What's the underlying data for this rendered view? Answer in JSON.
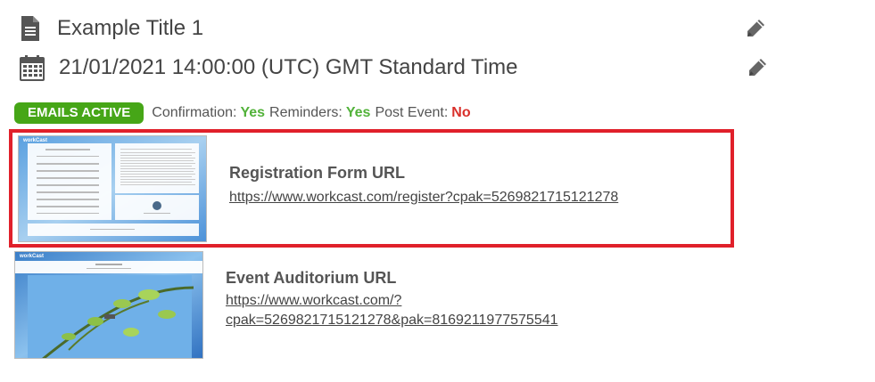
{
  "event": {
    "title": "Example Title 1",
    "datetime": "21/01/2021 14:00:00 (UTC) GMT Standard Time"
  },
  "status": {
    "badge": "EMAILS ACTIVE",
    "confirmation_label": "Confirmation:",
    "confirmation_value": "Yes",
    "reminders_label": "Reminders:",
    "reminders_value": "Yes",
    "post_event_label": "Post Event:",
    "post_event_value": "No"
  },
  "links": {
    "registration": {
      "title": "Registration Form URL",
      "url": "https://www.workcast.com/register?cpak=5269821715121278"
    },
    "auditorium": {
      "title": "Event Auditorium URL",
      "url_line1": "https://www.workcast.com/?",
      "url_line2": "cpak=5269821715121278&pak=8169211977575541"
    }
  },
  "thumbnails": {
    "logo": "workCast"
  },
  "colors": {
    "badge_green": "#46a617",
    "yes_green": "#52b23a",
    "no_red": "#d9302b",
    "highlight_red": "#e0202a"
  },
  "icons": {
    "title": "document-icon",
    "date": "calendar-icon",
    "edit": "pencil-icon"
  }
}
